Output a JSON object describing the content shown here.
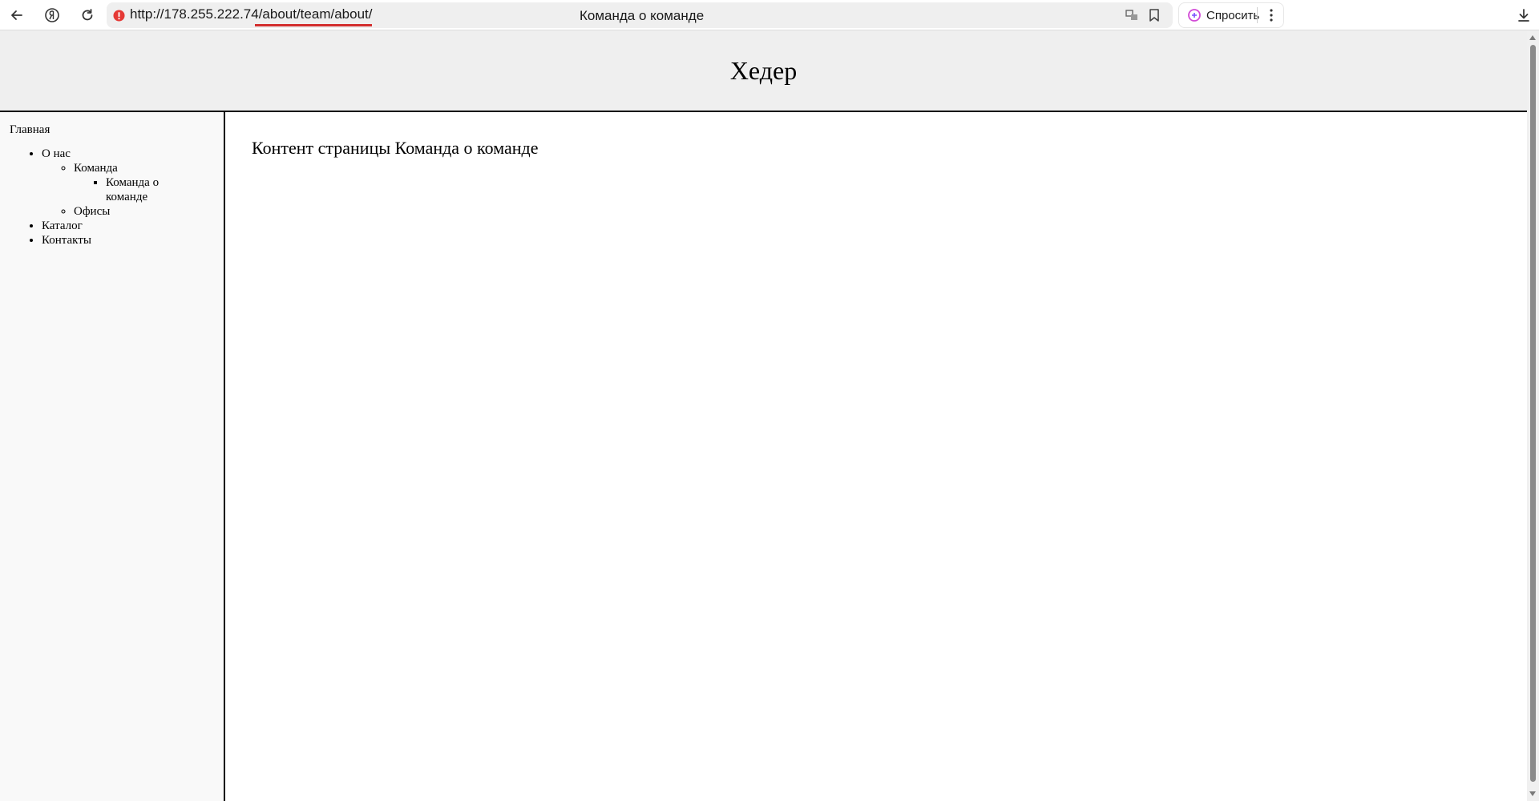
{
  "browser": {
    "url": "http://178.255.222.74/about/team/about/",
    "tab_title": "Команда о команде",
    "ask_label": "Спросить",
    "accent_color": "#d32f2f"
  },
  "header": {
    "title": "Хедер"
  },
  "sidebar": {
    "home": "Главная",
    "about": "О нас",
    "team": "Команда",
    "team_about": "Команда о команде",
    "offices": "Офисы",
    "catalog": "Каталог",
    "contacts": "Контакты"
  },
  "main": {
    "content": "Контент страницы Команда о команде"
  }
}
